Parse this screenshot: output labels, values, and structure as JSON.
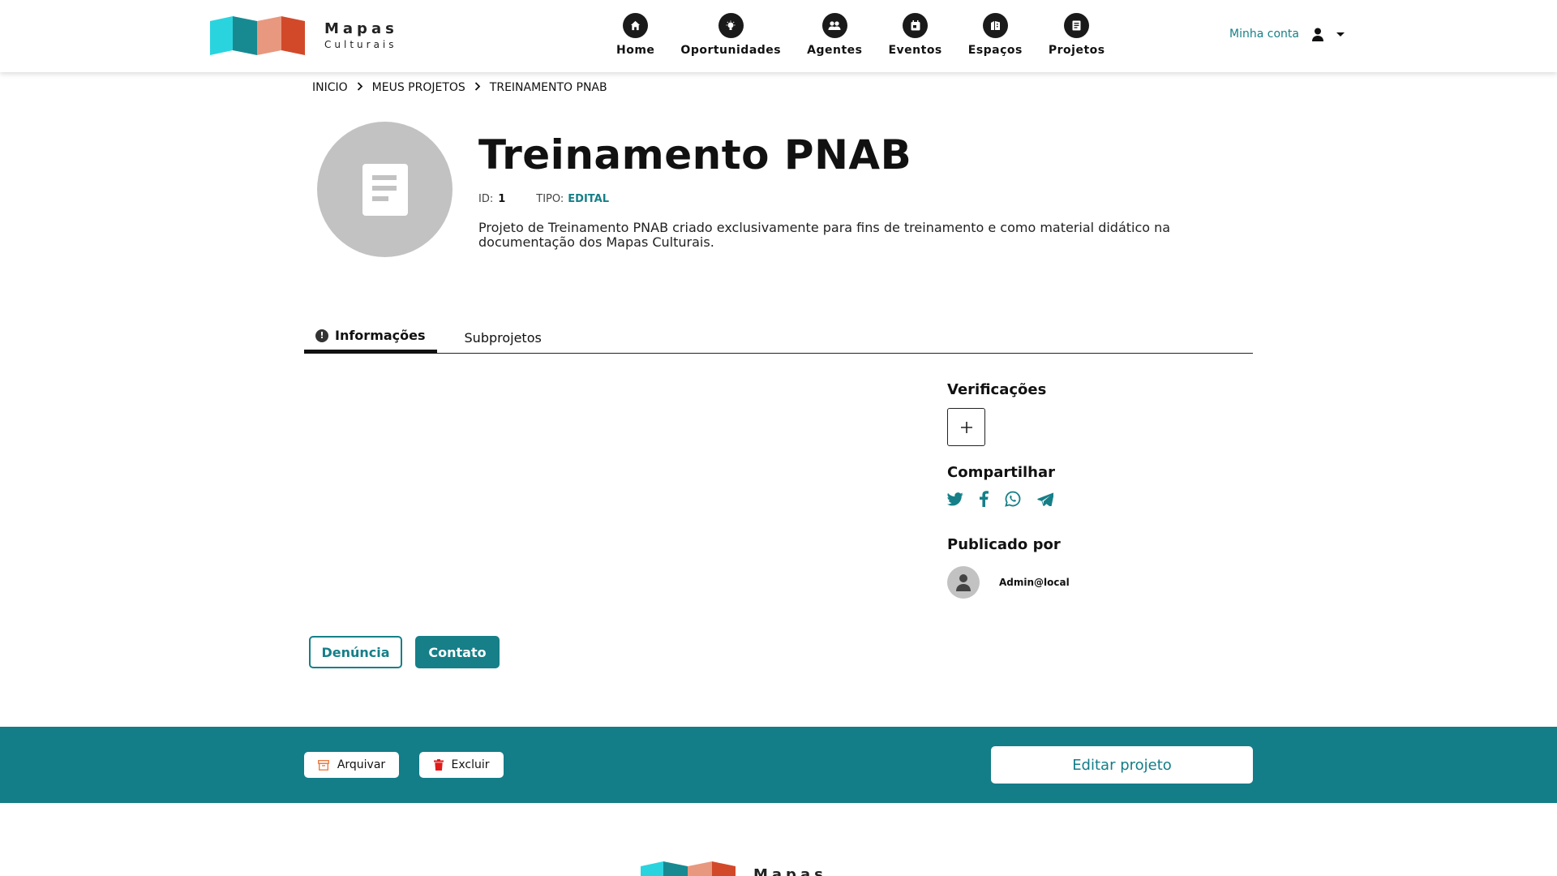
{
  "header": {
    "logo": {
      "line1": "Mapas",
      "line2": "Culturais"
    },
    "nav": [
      {
        "label": "Home",
        "icon": "home-icon"
      },
      {
        "label": "Oportunidades",
        "icon": "lightbulb-icon"
      },
      {
        "label": "Agentes",
        "icon": "people-icon"
      },
      {
        "label": "Eventos",
        "icon": "calendar-icon"
      },
      {
        "label": "Espaços",
        "icon": "building-icon"
      },
      {
        "label": "Projetos",
        "icon": "document-icon"
      }
    ],
    "account_label": "Minha conta"
  },
  "breadcrumb": [
    "INICIO",
    "MEUS PROJETOS",
    "TREINAMENTO PNAB"
  ],
  "project": {
    "title": "Treinamento PNAB",
    "id_label": "ID:",
    "id_value": "1",
    "tipo_label": "TIPO:",
    "tipo_value": "EDITAL",
    "description": "Projeto de Treinamento PNAB criado exclusivamente para fins de treinamento e como material didático na documentação dos Mapas Culturais."
  },
  "tabs": [
    {
      "label": "Informações",
      "active": true
    },
    {
      "label": "Subprojetos",
      "active": false
    }
  ],
  "sidebar": {
    "verificacoes_title": "Verificações",
    "compartilhar_title": "Compartilhar",
    "share_icons": [
      "twitter-icon",
      "facebook-icon",
      "whatsapp-icon",
      "telegram-icon"
    ],
    "publicado_title": "Publicado por",
    "publisher_name": "Admin@local"
  },
  "buttons": {
    "denuncia": "Denúncia",
    "contato": "Contato",
    "arquivar": "Arquivar",
    "excluir": "Excluir",
    "editar": "Editar projeto"
  },
  "footer": {
    "logo_line1": "Mapas"
  },
  "colors": {
    "primary": "#167f88",
    "actionbar": "#137d88",
    "logo_cyan": "#2ad4df",
    "logo_teal": "#178a91",
    "logo_salmon": "#e8987f",
    "logo_red": "#d2492a",
    "delete_red": "#e11b1b",
    "archive_orange": "#e8763a"
  }
}
